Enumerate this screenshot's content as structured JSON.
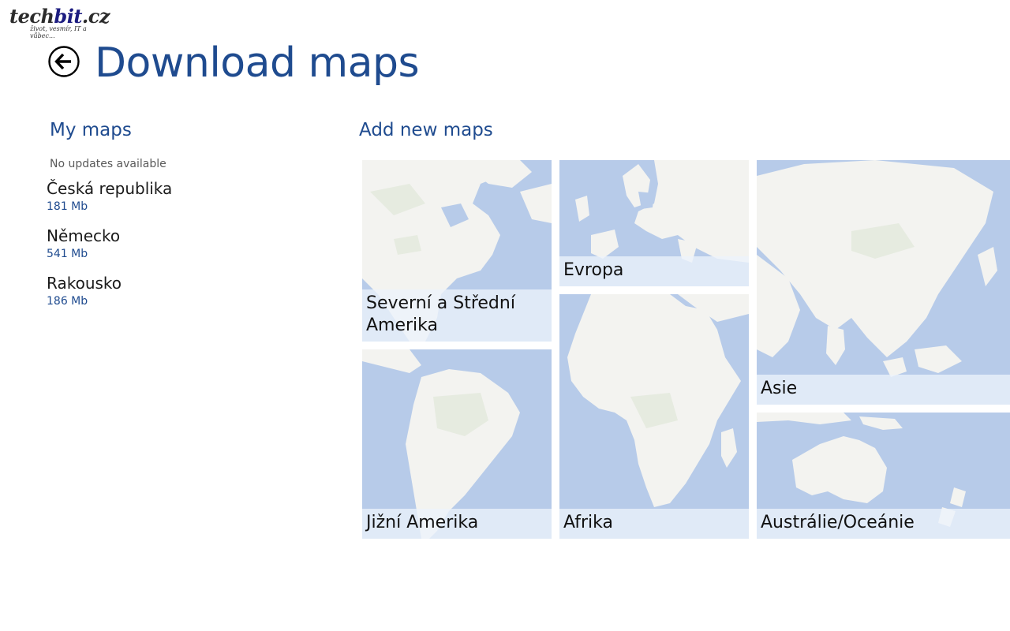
{
  "watermark": {
    "brand_part1": "tech",
    "brand_part2": "bit",
    "brand_part3": ".cz",
    "tagline": "život, vesmír, IT a vůbec..."
  },
  "header": {
    "title": "Download maps",
    "back_icon": "back-arrow-circle-icon"
  },
  "my_maps": {
    "title": "My maps",
    "status": "No updates available",
    "items": [
      {
        "name": "Česká republika",
        "size": "181 Mb"
      },
      {
        "name": "Německo",
        "size": "541 Mb"
      },
      {
        "name": "Rakousko",
        "size": "186 Mb"
      }
    ]
  },
  "add_maps": {
    "title": "Add new maps",
    "tiles": [
      {
        "label": "Severní a Střední Amerika",
        "region": "north-america"
      },
      {
        "label": "Evropa",
        "region": "europe"
      },
      {
        "label": "Asie",
        "region": "asia"
      },
      {
        "label": "Jižní Amerika",
        "region": "south-america"
      },
      {
        "label": "Afrika",
        "region": "africa"
      },
      {
        "label": "Austrálie/Oceánie",
        "region": "australia"
      }
    ]
  },
  "colors": {
    "accent": "#1f4b8f",
    "ocean": "#b7cbe9",
    "land": "#f3f3f0",
    "label_bg": "#ecf2fb"
  }
}
